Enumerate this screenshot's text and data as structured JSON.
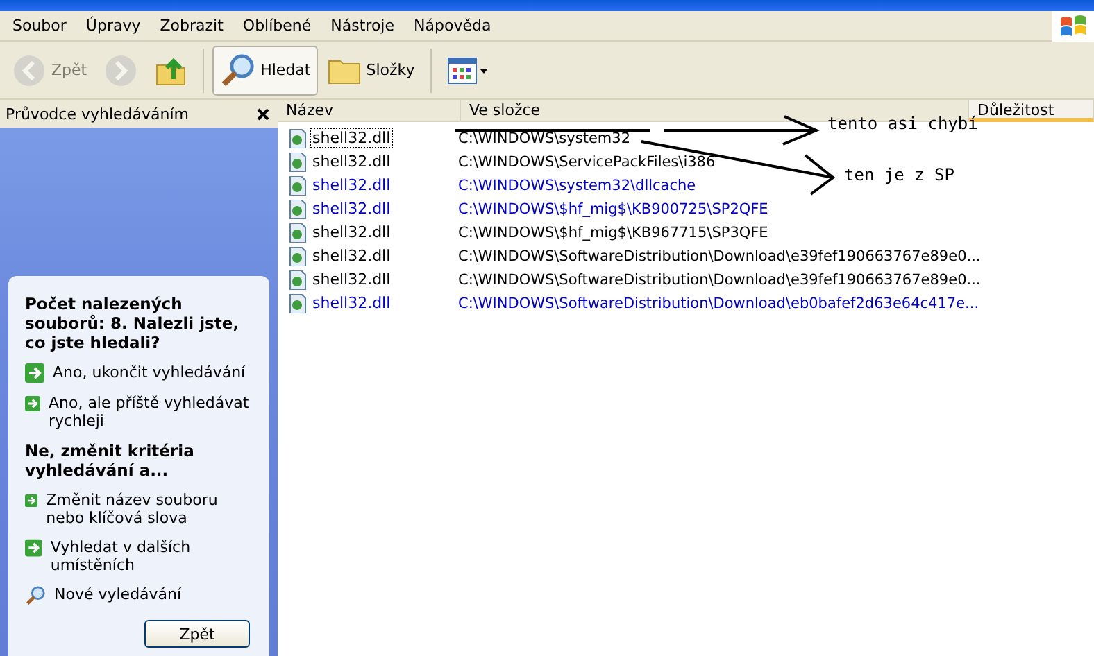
{
  "menu": [
    "Soubor",
    "Úpravy",
    "Zobrazit",
    "Oblíbené",
    "Nástroje",
    "Nápověda"
  ],
  "toolbar": [
    {
      "kind": "back",
      "label": "Zpět",
      "disabled": true,
      "selected": false
    },
    {
      "kind": "forward",
      "disabled": true,
      "selected": false
    },
    {
      "kind": "up",
      "disabled": false,
      "selected": false
    },
    {
      "kind": "search",
      "label": "Hledat",
      "disabled": false,
      "selected": true
    },
    {
      "kind": "folders",
      "label": "Složky",
      "disabled": false,
      "selected": false
    },
    {
      "kind": "views",
      "disabled": false,
      "selected": false
    }
  ],
  "search_pane": {
    "title": "Průvodce vyhledáváním",
    "heading": "Počet nalezených souborů: 8. Nalezli jste, co jste hledali?",
    "links": [
      {
        "kind": "arrow",
        "label": "Ano, ukončit vyhledávání"
      },
      {
        "kind": "arrow",
        "label": "Ano, ale příště vyhledávat rychleji"
      },
      {
        "kind": "heading",
        "label": "Ne, změnit kritéria vyhledávání a..."
      },
      {
        "kind": "arrow",
        "label": "Změnit název souboru nebo klíčová slova"
      },
      {
        "kind": "arrow",
        "label": "Vyhledat v dalších umístěních"
      },
      {
        "kind": "search",
        "label": "Nové vyledávání"
      }
    ],
    "back_button": "Zpět"
  },
  "table": {
    "columns": [
      {
        "label": "Název",
        "sorted": false
      },
      {
        "label": "Ve složce",
        "sorted": false
      },
      {
        "label": "Důležitost",
        "sorted": true
      }
    ],
    "rows": [
      {
        "name": "shell32.dll",
        "folder": "C:\\WINDOWS\\system32",
        "compressed": false,
        "selected": true
      },
      {
        "name": "shell32.dll",
        "folder": "C:\\WINDOWS\\ServicePackFiles\\i386",
        "compressed": false,
        "selected": false
      },
      {
        "name": "shell32.dll",
        "folder": "C:\\WINDOWS\\system32\\dllcache",
        "compressed": true,
        "selected": false
      },
      {
        "name": "shell32.dll",
        "folder": "C:\\WINDOWS\\$hf_mig$\\KB900725\\SP2QFE",
        "compressed": true,
        "selected": false
      },
      {
        "name": "shell32.dll",
        "folder": "C:\\WINDOWS\\$hf_mig$\\KB967715\\SP3QFE",
        "compressed": false,
        "selected": false
      },
      {
        "name": "shell32.dll",
        "folder": "C:\\WINDOWS\\SoftwareDistribution\\Download\\e39fef190663767e89e0...",
        "compressed": false,
        "selected": false
      },
      {
        "name": "shell32.dll",
        "folder": "C:\\WINDOWS\\SoftwareDistribution\\Download\\e39fef190663767e89e0...",
        "compressed": false,
        "selected": false
      },
      {
        "name": "shell32.dll",
        "folder": "C:\\WINDOWS\\SoftwareDistribution\\Download\\eb0bafef2d63e64c417e...",
        "compressed": true,
        "selected": false
      }
    ]
  },
  "annotations": [
    "tento asi chybí",
    "ten je z SP"
  ]
}
